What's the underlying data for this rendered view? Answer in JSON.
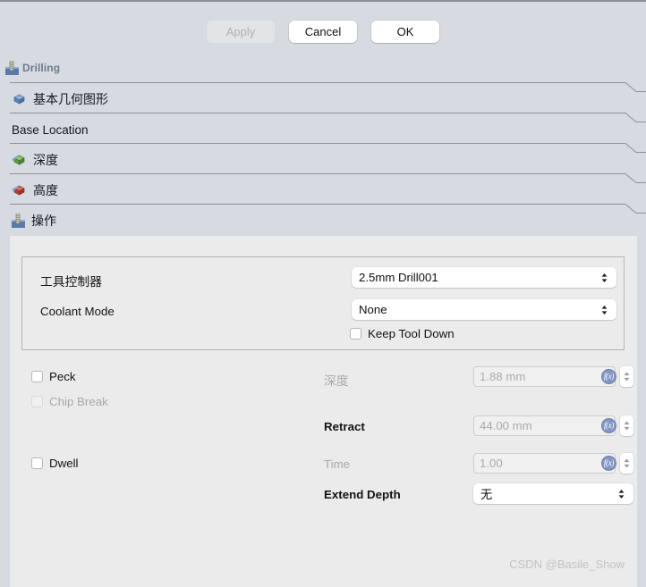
{
  "window": {
    "title": "Drilling",
    "title_icon": "drill-icon"
  },
  "buttonbar": {
    "apply_label": "Apply",
    "cancel_label": "Cancel",
    "ok_label": "OK"
  },
  "sections": [
    {
      "label": "基本几何图形",
      "icon": "blue-cube-icon",
      "has_icon": true,
      "cjk": true
    },
    {
      "label": "Base Location",
      "icon": "",
      "has_icon": false,
      "cjk": false
    },
    {
      "label": "深度",
      "icon": "green-cube-icon",
      "has_icon": true,
      "cjk": true
    },
    {
      "label": "高度",
      "icon": "red-cube-icon",
      "has_icon": true,
      "cjk": true
    },
    {
      "label": "操作",
      "icon": "drill-icon",
      "has_icon": true,
      "cjk": true
    }
  ],
  "form": {
    "tool_controller_label": "工具控制器",
    "tool_controller_value": "2.5mm Drill001",
    "coolant_mode_label": "Coolant Mode",
    "coolant_mode_value": "None",
    "keep_tool_down_label": "Keep Tool Down",
    "peck_label": "Peck",
    "chip_break_label": "Chip Break",
    "dwell_label": "Dwell",
    "depth_label": "深度",
    "depth_value": "1.88 mm",
    "retract_label": "Retract",
    "retract_value": "44.00 mm",
    "time_label": "Time",
    "time_value": "1.00",
    "extend_depth_label": "Extend Depth",
    "extend_depth_value": "无",
    "fx_glyph": "f(x)"
  },
  "watermark": {
    "text": "CSDN @Basile_Show"
  },
  "colors": {
    "window_background": "#d6dae1",
    "panel_background": "#ebebeb",
    "title_text": "#6f7a8c",
    "fx_button": "#8296c4",
    "divider": "#8f9298"
  }
}
